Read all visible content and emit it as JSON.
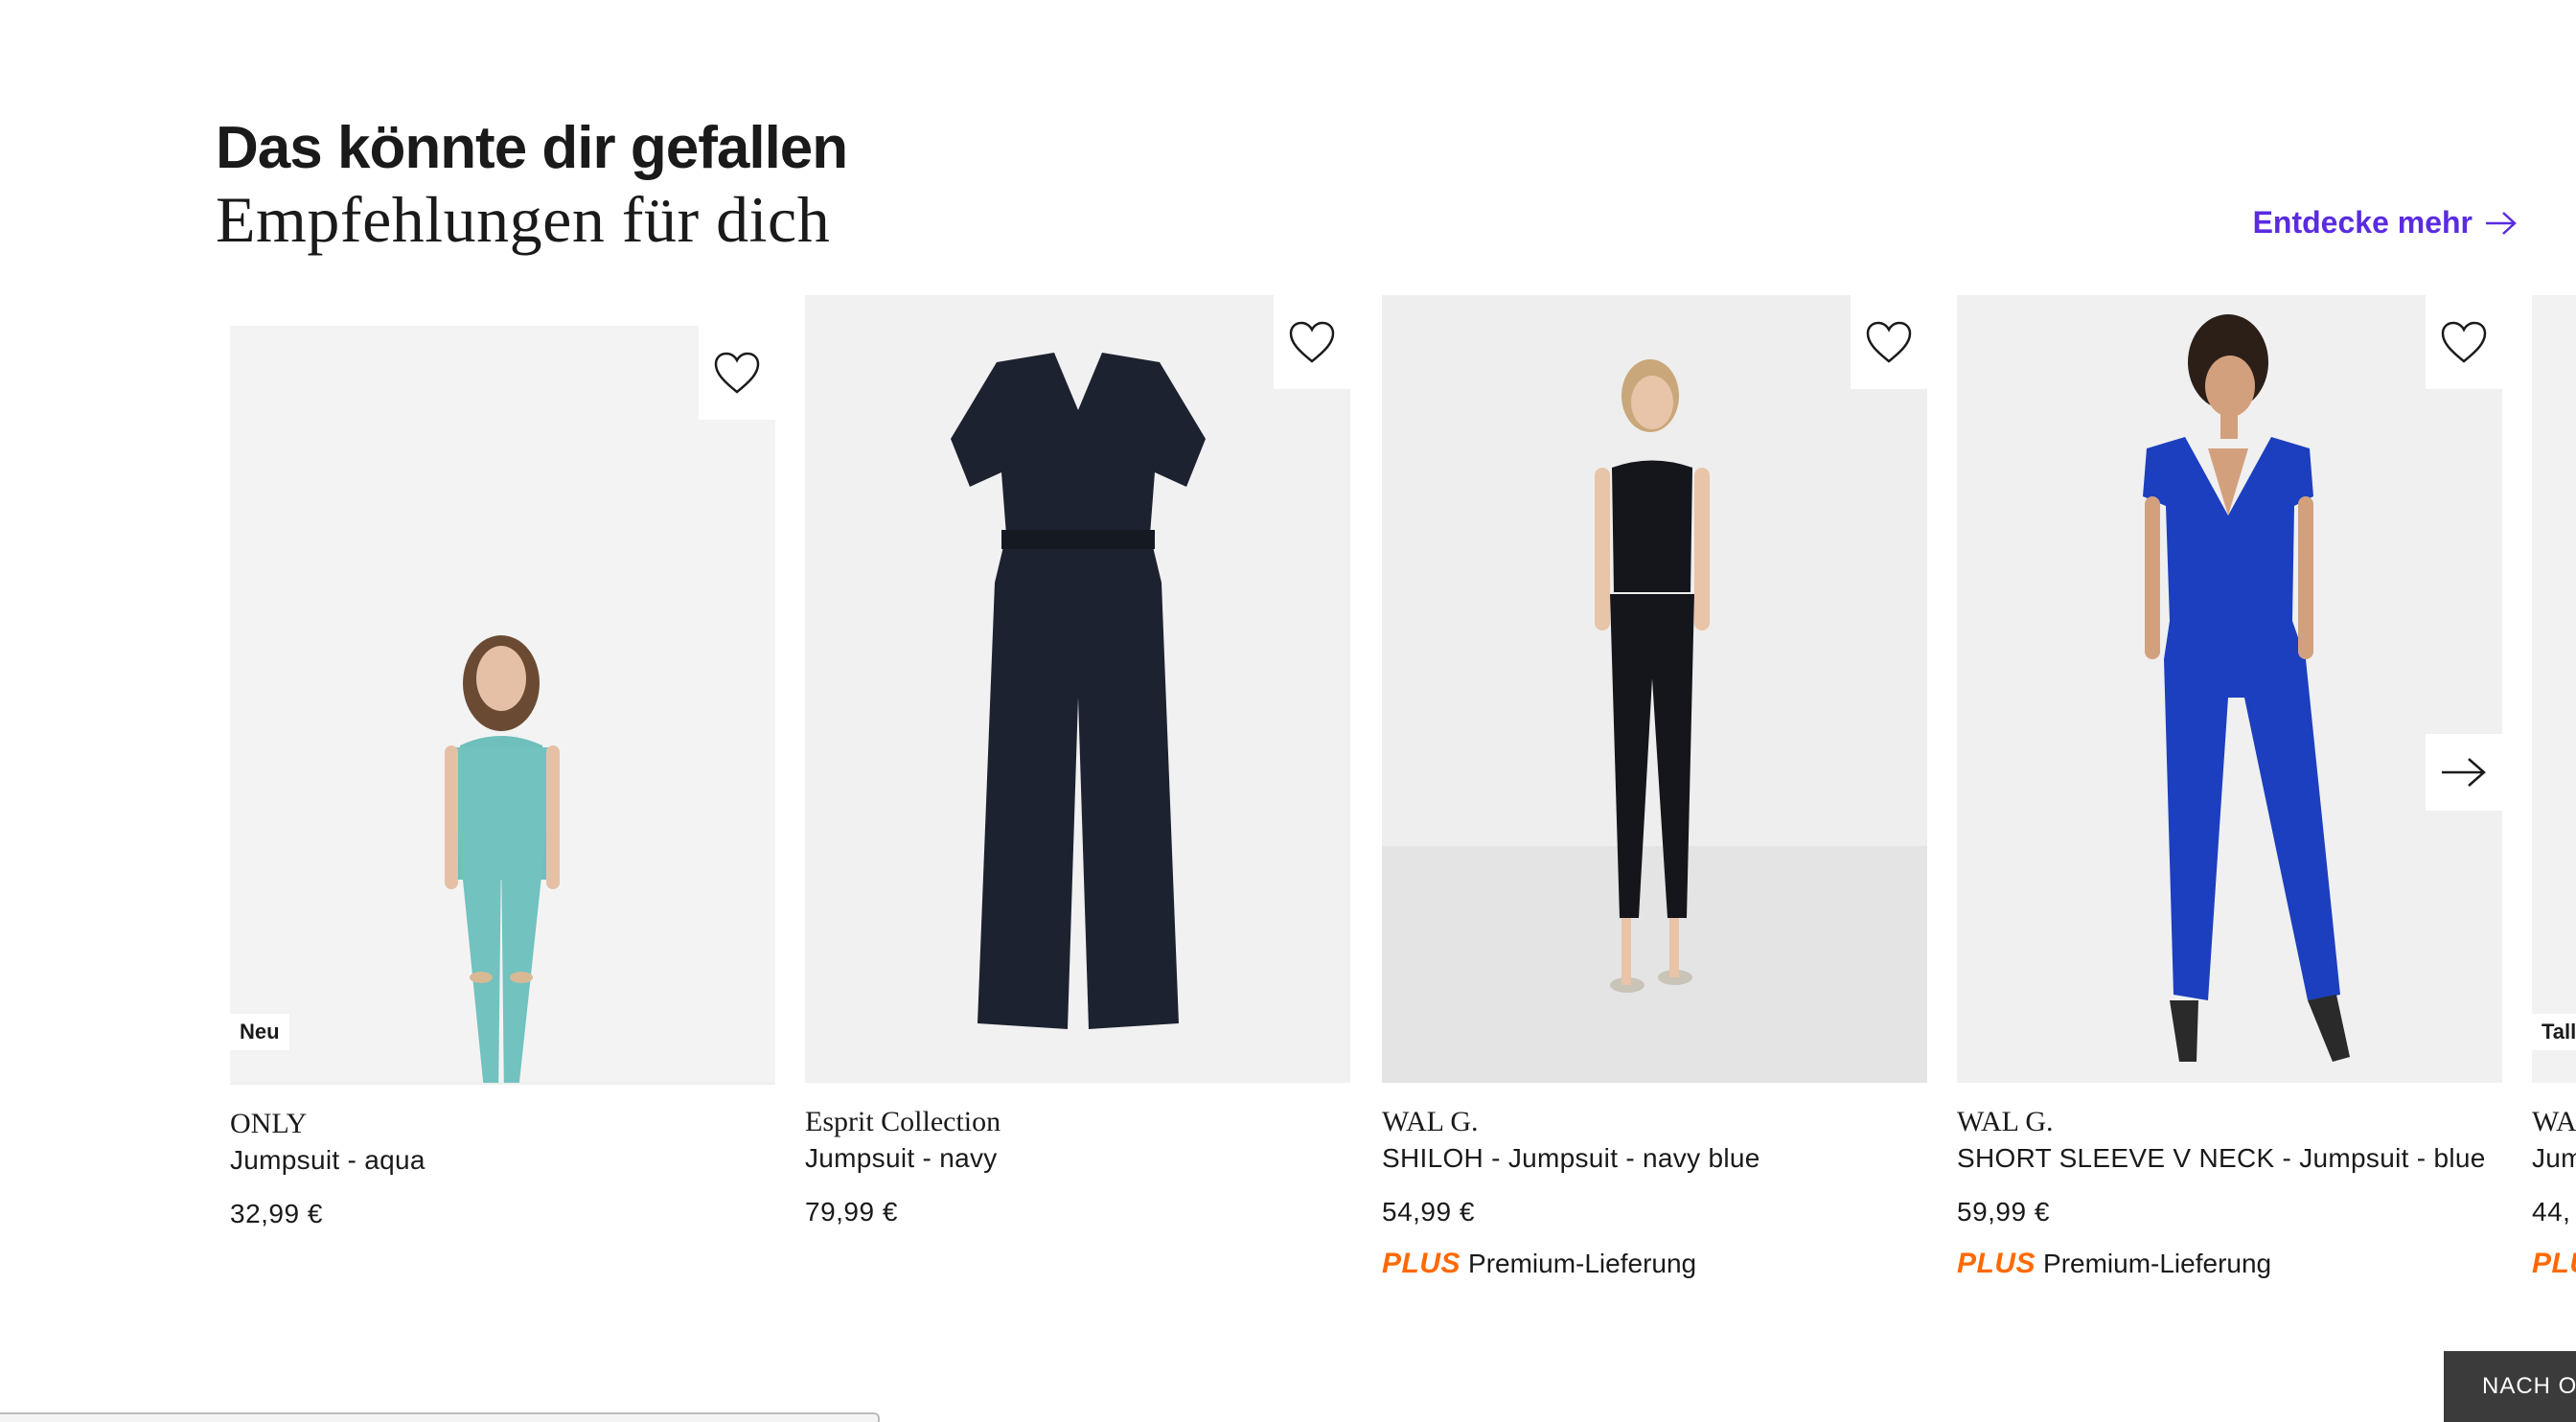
{
  "section": {
    "title": "Das könnte dir gefallen",
    "subtitle": "Empfehlungen für dich",
    "discover_label": "Entdecke mehr"
  },
  "products": [
    {
      "brand": "ONLY",
      "name": "Jumpsuit - aqua",
      "price": "32,99 €",
      "badge": "Neu",
      "color": "#6fbfbd"
    },
    {
      "brand": "Esprit Collection",
      "name": "Jumpsuit - navy",
      "price": "79,99 €",
      "color": "#1d2230"
    },
    {
      "brand": "WAL G.",
      "name": "SHILOH - Jumpsuit - navy blue",
      "price": "54,99 €",
      "plus_word": "PLUS",
      "plus_label": "Premium-Lieferung",
      "color": "#15161c"
    },
    {
      "brand": "WAL G.",
      "name": "SHORT SLEEVE V NECK - Jumpsuit - blue",
      "price": "59,99 €",
      "plus_word": "PLUS",
      "plus_label": "Premium-Lieferung",
      "color": "#1c3fbf"
    },
    {
      "brand": "WA",
      "name": "Jum",
      "price": "44,",
      "badge": "Tall",
      "plus_word": "PLU"
    }
  ],
  "scroll_top_label": "NACH O",
  "icons": {
    "wishlist": "heart-icon",
    "next": "arrow-right-icon",
    "discover": "arrow-right-icon"
  }
}
